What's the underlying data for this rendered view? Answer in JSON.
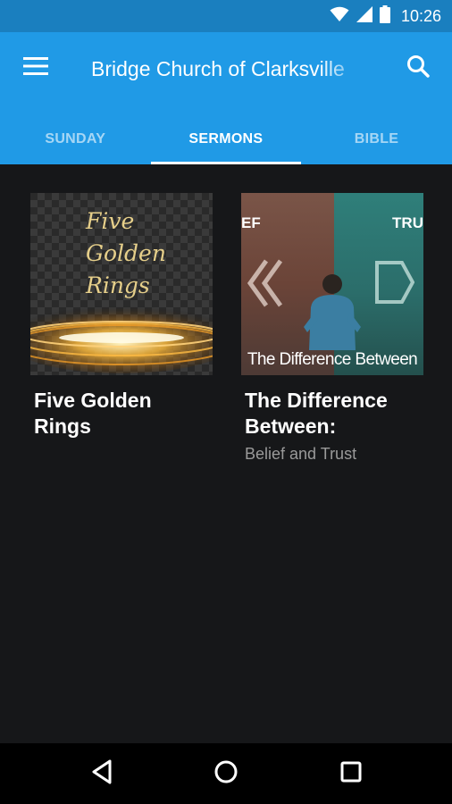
{
  "status_bar": {
    "time": "10:26",
    "icons": [
      "wifi-icon",
      "cellular-signal-icon",
      "battery-icon"
    ]
  },
  "app_bar": {
    "title": "Bridge Church of Clarksville",
    "menu_icon": "hamburger-menu-icon",
    "search_icon": "search-icon",
    "color": "#209ae6"
  },
  "tabs": [
    {
      "label": "SUNDAY",
      "active": false
    },
    {
      "label": "SERMONS",
      "active": true
    },
    {
      "label": "BIBLE",
      "active": false
    }
  ],
  "sermons": [
    {
      "title": "Five Golden Rings",
      "subtitle": "",
      "thumbnail_text": [
        "Five",
        "Golden",
        "Rings"
      ]
    },
    {
      "title": "The Difference Between:",
      "subtitle": "Belief and Trust",
      "thumbnail_left_word": "EF",
      "thumbnail_right_word": "TRU",
      "thumbnail_caption": "The Difference Between"
    }
  ],
  "nav_bar": {
    "icons": [
      "back-icon",
      "home-icon",
      "recents-icon"
    ]
  },
  "colors": {
    "status_bar": "#1a7fbf",
    "background": "#161719",
    "subtitle": "#9a9a9a"
  }
}
